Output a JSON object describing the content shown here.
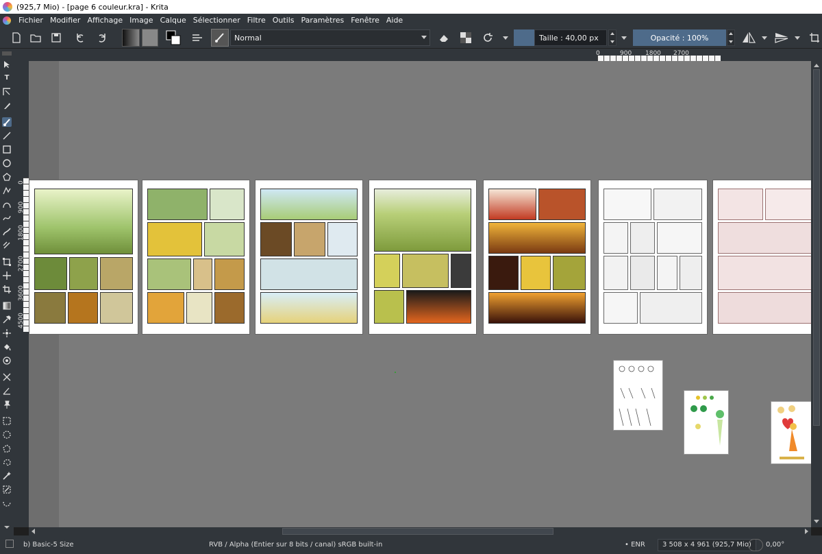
{
  "window": {
    "title": "(925,7 Mio)  - [page 6 couleur.kra] - Krita"
  },
  "menu": [
    "Fichier",
    "Modifier",
    "Affichage",
    "Image",
    "Calque",
    "Sélectionner",
    "Filtre",
    "Outils",
    "Paramètres",
    "Fenêtre",
    "Aide"
  ],
  "toolbar": {
    "blend_mode": "Normal",
    "size_label": "Taille :  40,00 px",
    "opacity_label": "Opacité : 100%"
  },
  "ruler_top": [
    "0",
    "900",
    "1800",
    "2700"
  ],
  "ruler_left": [
    "0",
    "900",
    "1800",
    "2700",
    "3600",
    "4500"
  ],
  "canvas": {
    "pages": [
      {
        "name": "page-1",
        "style": "color"
      },
      {
        "name": "page-2",
        "style": "color"
      },
      {
        "name": "page-3",
        "style": "color"
      },
      {
        "name": "page-4",
        "style": "color"
      },
      {
        "name": "page-5",
        "style": "color"
      },
      {
        "name": "page-6",
        "style": "lineart"
      },
      {
        "name": "page-7",
        "style": "sketch"
      }
    ]
  },
  "status": {
    "brush_preset": "b) Basic-5 Size",
    "color_space": "RVB / Alpha (Entier sur 8 bits / canal)  sRGB built-in",
    "save_indicator": "• ENR",
    "dimensions": "3 508 x 4 961 (925,7 Mio)",
    "rotation": "0,00°"
  },
  "colors": {
    "accent": "#4e6b8a",
    "canvas_bg": "#7b7b7b",
    "chrome": "#31363b"
  }
}
